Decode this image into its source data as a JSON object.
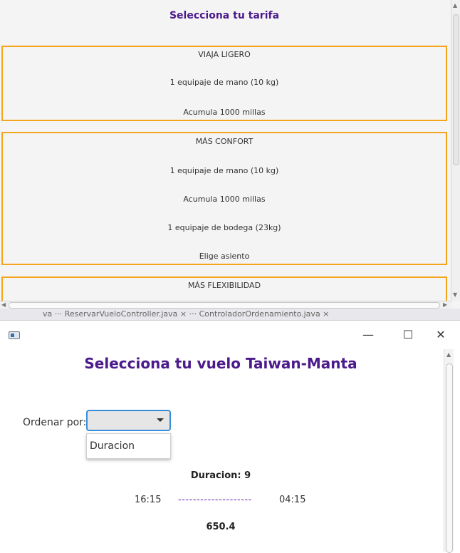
{
  "tariff_window": {
    "title": "Selecciona tu tarifa",
    "fares": [
      {
        "name": "VIAJA LIGERO",
        "features": [
          "1 equipaje de mano (10 kg)",
          "Acumula 1000 millas"
        ]
      },
      {
        "name": "MÁS CONFORT",
        "features": [
          "1 equipaje de mano (10 kg)",
          "Acumula 1000 millas",
          "1 equipaje de bodega (23kg)",
          "Elige asiento"
        ]
      },
      {
        "name": "MÁS FLEXIBILIDAD",
        "features": []
      }
    ]
  },
  "taskbar": {
    "text": "va ··· ReservarVueloController.java ×   ··· ControladorOrdenamiento.java ×"
  },
  "flight_window": {
    "title": "Selecciona tu vuelo Taiwan-Manta",
    "sort_label": "Ordenar por:",
    "sort_selected": "",
    "sort_options": [
      "Duracion"
    ],
    "flight": {
      "duration": "Duracion: 9",
      "departure": "16:15",
      "route_line": "--------------------",
      "arrival": "04:15",
      "price": "650.4"
    },
    "window_controls": {
      "minimize": "—",
      "maximize": "☐",
      "close": "✕"
    }
  },
  "colors": {
    "accent": "#4b1a8b",
    "fare_border": "#f4a51c",
    "focus": "#3a8ed8",
    "route_line": "#6a28b7"
  }
}
